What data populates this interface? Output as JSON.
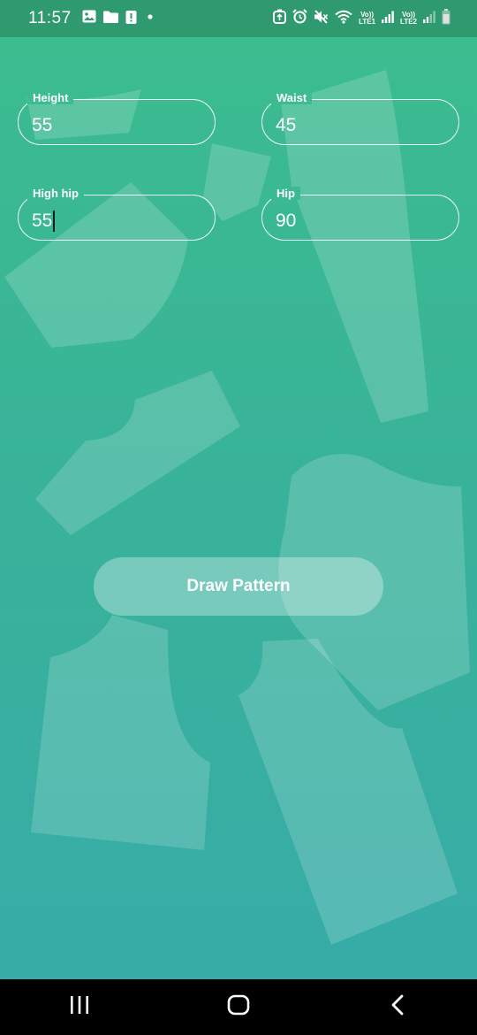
{
  "status_bar": {
    "time": "11:57",
    "left_icons": [
      "image-icon",
      "folder-icon",
      "alert-icon",
      "dot-icon"
    ],
    "right_icons": [
      "battery-saver-icon",
      "alarm-icon",
      "mute-icon",
      "wifi-icon",
      "signal-lte1-icon",
      "signal-lte2-icon",
      "battery-icon"
    ],
    "lte1_label_top": "Vo))",
    "lte1_label_bottom": "LTE1",
    "lte2_label_top": "Vo))",
    "lte2_label_bottom": "LTE2"
  },
  "form": {
    "height": {
      "label": "Height",
      "value": "55"
    },
    "waist": {
      "label": "Waist",
      "value": "45"
    },
    "high_hip": {
      "label": "High hip",
      "value": "55"
    },
    "hip": {
      "label": "Hip",
      "value": "90"
    }
  },
  "actions": {
    "draw_pattern_label": "Draw Pattern"
  },
  "nav_bar": {
    "buttons": [
      "recent-apps-icon",
      "home-icon",
      "back-icon"
    ]
  },
  "colors": {
    "gradient_top": "#3cbd8e",
    "gradient_bottom": "#37aba9",
    "status_bar": "#2f9a6f",
    "nav_bar": "#000000",
    "text": "#ffffff"
  }
}
